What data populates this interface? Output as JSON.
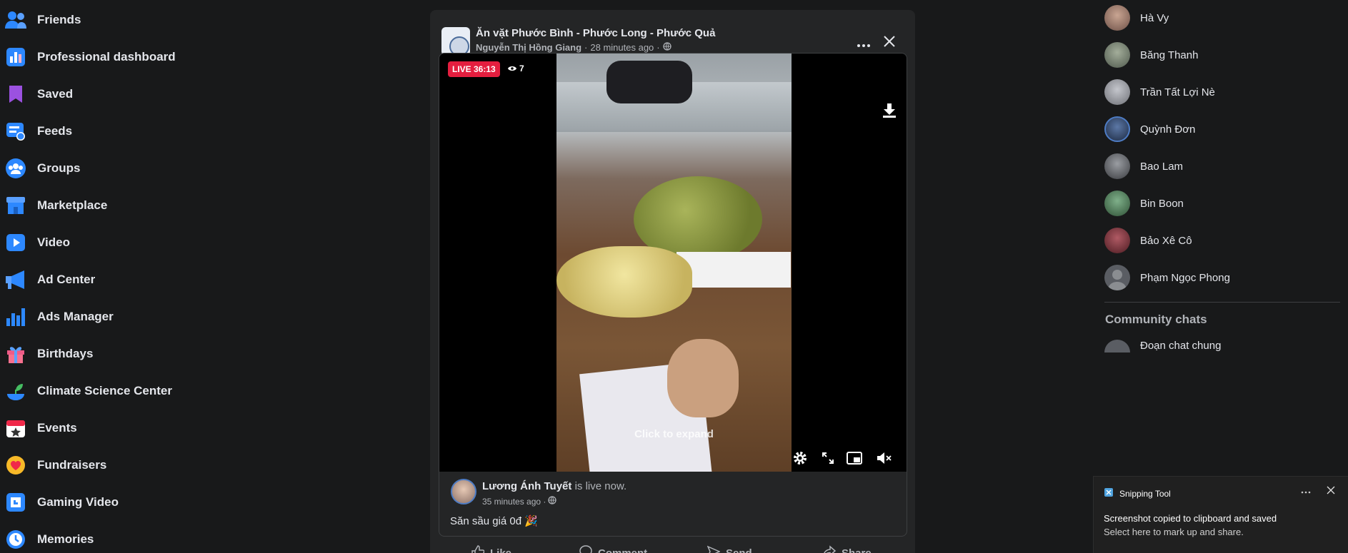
{
  "sidebar": {
    "items": [
      {
        "label": "Friends",
        "icon": "friends-icon",
        "color": "#2d88ff"
      },
      {
        "label": "Professional dashboard",
        "icon": "dashboard-icon",
        "color": "#2d88ff"
      },
      {
        "label": "Saved",
        "icon": "bookmark-icon",
        "color": "#9b51e0"
      },
      {
        "label": "Feeds",
        "icon": "feeds-icon",
        "color": "#2d88ff"
      },
      {
        "label": "Groups",
        "icon": "groups-icon",
        "color": "#2d88ff"
      },
      {
        "label": "Marketplace",
        "icon": "marketplace-icon",
        "color": "#2d88ff"
      },
      {
        "label": "Video",
        "icon": "video-icon",
        "color": "#2d88ff"
      },
      {
        "label": "Ad Center",
        "icon": "megaphone-icon",
        "color": "#2d88ff"
      },
      {
        "label": "Ads Manager",
        "icon": "bar-chart-icon",
        "color": "#2d88ff"
      },
      {
        "label": "Birthdays",
        "icon": "gift-icon",
        "color": "#ee5b86"
      },
      {
        "label": "Climate Science Center",
        "icon": "sprout-icon",
        "color": "#45bd62"
      },
      {
        "label": "Events",
        "icon": "calendar-icon",
        "color": "#f02849"
      },
      {
        "label": "Fundraisers",
        "icon": "heart-icon",
        "color": "#f7b928"
      },
      {
        "label": "Gaming Video",
        "icon": "gaming-icon",
        "color": "#2d88ff"
      },
      {
        "label": "Memories",
        "icon": "clock-icon",
        "color": "#2d88ff"
      }
    ]
  },
  "post": {
    "page_name": "Ăn vặt Phước Bình - Phước Long - Phước Quả",
    "author": "Nguyễn Thị Hồng Giang",
    "time": "28 minutes ago",
    "separator": "·",
    "video": {
      "live_label": "LIVE 36:13",
      "viewers": "7",
      "hint": "Click to expand"
    },
    "live_by": {
      "name": "Lương Ánh Tuyết",
      "status": "is live now.",
      "time": "35 minutes ago ·"
    },
    "caption": "Săn sầu giá 0đ 🎉",
    "actions": {
      "like": "Like",
      "comment": "Comment",
      "send": "Send",
      "share": "Share"
    }
  },
  "contacts": {
    "people": [
      {
        "name": "Hà Vy",
        "color": "#8a6f66"
      },
      {
        "name": "Băng Thanh",
        "color": "#6e7b6a"
      },
      {
        "name": "Trần Tất Lợi Nè",
        "color": "#8c8f96"
      },
      {
        "name": "Quỳnh Đơn",
        "color": "#33476b"
      },
      {
        "name": "Bao Lam",
        "color": "#55585c"
      },
      {
        "name": "Bin Boon",
        "color": "#3f6f4a"
      },
      {
        "name": "Bảo Xê Cô",
        "color": "#7a2d34"
      },
      {
        "name": "Phạm Ngọc Phong",
        "color": "#5a5d63"
      }
    ],
    "community_title": "Community chats",
    "partial_chat": "Đoạn chat chung"
  },
  "toast": {
    "app": "Snipping Tool",
    "line1": "Screenshot copied to clipboard and saved",
    "line2": "Select here to mark up and share."
  }
}
